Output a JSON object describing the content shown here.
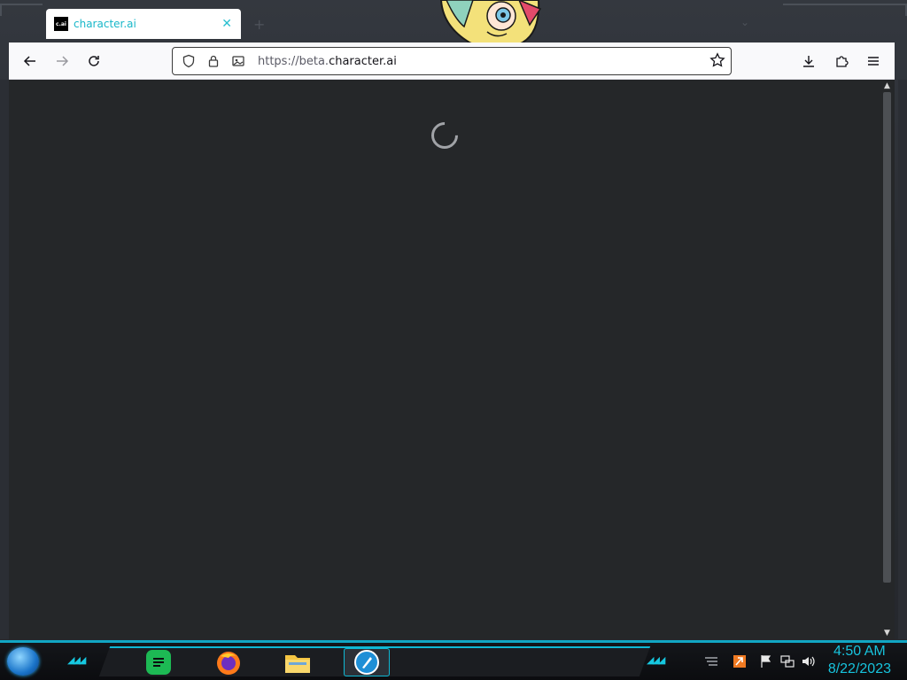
{
  "browser": {
    "tab": {
      "favicon_text": "c.ai",
      "title": "character.ai"
    },
    "url": {
      "scheme": "https://",
      "subdomain": "beta.",
      "domain": "character.ai"
    }
  },
  "taskbar": {
    "clock": {
      "time": "4:50 AM",
      "date": "8/22/2023"
    },
    "apps": [
      "chat-app",
      "firefox",
      "file-explorer",
      "active-app"
    ]
  },
  "colors": {
    "accent": "#17c3dd",
    "content_bg": "#252729",
    "toolbar_bg": "#f9f9fb"
  }
}
